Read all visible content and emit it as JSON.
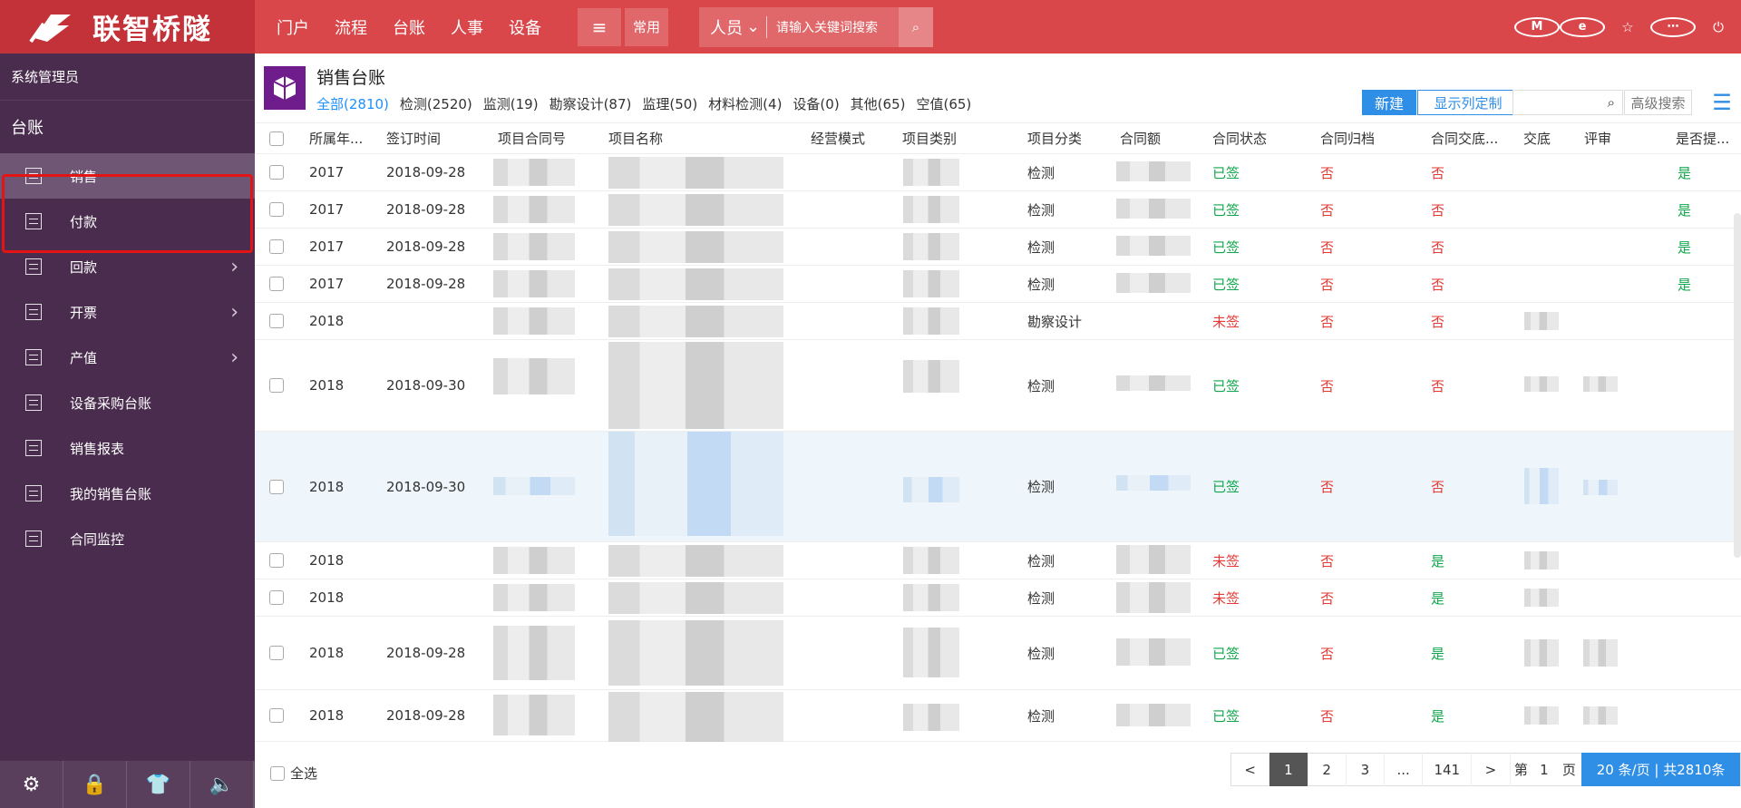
{
  "topbar": {
    "brand": "联智桥隧",
    "nav": [
      "门户",
      "流程",
      "台账",
      "人事",
      "设备"
    ],
    "menu_icon": "menu-icon",
    "common": "常用",
    "scope": "人员",
    "search_placeholder": "请输入关键词搜索",
    "icons": [
      "m-icon",
      "e-icon",
      "star-icon",
      "more-icon",
      "power-icon"
    ]
  },
  "sidebar": {
    "user": "系统管理员",
    "title": "台账",
    "items": [
      {
        "label": "销售",
        "chevron": false
      },
      {
        "label": "付款",
        "chevron": false
      },
      {
        "label": "回款",
        "chevron": true
      },
      {
        "label": "开票",
        "chevron": true
      },
      {
        "label": "产值",
        "chevron": true
      },
      {
        "label": "设备采购台账",
        "chevron": false
      },
      {
        "label": "销售报表",
        "chevron": false
      },
      {
        "label": "我的销售台账",
        "chevron": false
      },
      {
        "label": "合同监控",
        "chevron": false
      }
    ],
    "bottom_icons": [
      "settings-icon",
      "lock-icon",
      "shirt-icon",
      "speaker-icon"
    ]
  },
  "main": {
    "title": "销售台账",
    "tabs": [
      "全部(2810)",
      "检测(2520)",
      "监测(19)",
      "勘察设计(87)",
      "监理(50)",
      "材料检测(4)",
      "设备(0)",
      "其他(65)",
      "空值(65)"
    ],
    "new_button": "新建",
    "custom_button": "显示列定制",
    "advanced_search": "高级搜索",
    "columns": [
      "所属年...",
      "签订时间",
      "项目合同号",
      "项目名称",
      "经营模式",
      "项目类别",
      "项目分类",
      "合同额",
      "合同状态",
      "合同归档",
      "合同交底...",
      "交底",
      "评审",
      "是否提..."
    ]
  },
  "rows": [
    {
      "year": "2017",
      "date": "2018-09-28",
      "category": "检测",
      "status": "已签",
      "archive": "否",
      "delivery": "否",
      "submit": "是"
    },
    {
      "year": "2017",
      "date": "2018-09-28",
      "category": "检测",
      "status": "已签",
      "archive": "否",
      "delivery": "否",
      "submit": "是"
    },
    {
      "year": "2017",
      "date": "2018-09-28",
      "category": "检测",
      "status": "已签",
      "archive": "否",
      "delivery": "否",
      "submit": "是"
    },
    {
      "year": "2017",
      "date": "2018-09-28",
      "category": "检测",
      "status": "已签",
      "archive": "否",
      "delivery": "否",
      "submit": "是"
    },
    {
      "year": "2018",
      "date": "",
      "category": "勘察设计",
      "status": "未签",
      "archive": "否",
      "delivery": "否",
      "submit": ""
    },
    {
      "year": "2018",
      "date": "2018-09-30",
      "category": "检测",
      "status": "已签",
      "archive": "否",
      "delivery": "否",
      "submit": ""
    },
    {
      "year": "2018",
      "date": "2018-09-30",
      "category": "检测",
      "status": "已签",
      "archive": "否",
      "delivery": "否",
      "submit": ""
    },
    {
      "year": "2018",
      "date": "",
      "category": "检测",
      "status": "未签",
      "archive": "否",
      "delivery": "是",
      "submit": ""
    },
    {
      "year": "2018",
      "date": "",
      "category": "检测",
      "status": "未签",
      "archive": "否",
      "delivery": "是",
      "submit": ""
    },
    {
      "year": "2018",
      "date": "2018-09-28",
      "category": "检测",
      "status": "已签",
      "archive": "否",
      "delivery": "是",
      "submit": ""
    },
    {
      "year": "2018",
      "date": "2018-09-28",
      "category": "检测",
      "status": "已签",
      "archive": "否",
      "delivery": "是",
      "submit": ""
    }
  ],
  "footer": {
    "select_all": "全选",
    "prev": "<",
    "pages": [
      "1",
      "2",
      "3",
      "...",
      "141"
    ],
    "next": ">",
    "page_label": "第",
    "page_current": "1",
    "page_unit": "页",
    "page_size_text": "20 条/页 | 共2810条"
  }
}
